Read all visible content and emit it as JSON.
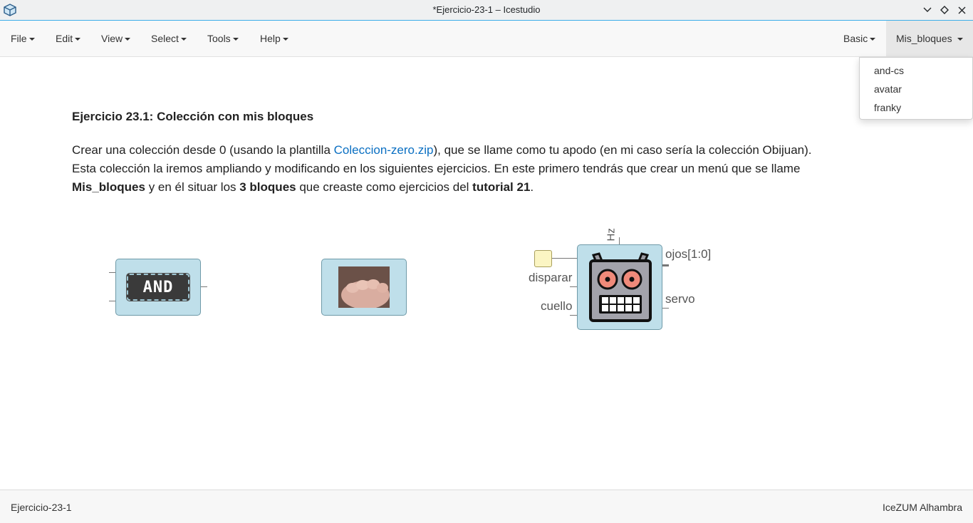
{
  "window": {
    "title": "*Ejercicio-23-1 – Icestudio",
    "icon": "icestudio-logo-icon",
    "controls": [
      "minimize-icon",
      "maximize-icon",
      "close-icon"
    ]
  },
  "menubar": {
    "left": [
      {
        "label": "File"
      },
      {
        "label": "Edit"
      },
      {
        "label": "View"
      },
      {
        "label": "Select"
      },
      {
        "label": "Tools"
      },
      {
        "label": "Help"
      }
    ],
    "right": [
      {
        "label": "Basic"
      },
      {
        "label": "Mis_bloques",
        "active": true
      }
    ]
  },
  "dropdown": {
    "items": [
      "and-cs",
      "avatar",
      "franky"
    ]
  },
  "document": {
    "heading": "Ejercicio 23.1: Colección con mis bloques",
    "p1_a": "Crear una colección desde 0 (usando la plantilla ",
    "p1_link": "Coleccion-zero.zip",
    "p1_b": "), que se llame como tu apodo (en mi caso sería la colección Obijuan).",
    "p2": "Esta colección la iremos ampliando y modificando en los siguientes ejercicios. En este primero tendrás que crear un menú que se llame",
    "p3_bold1": "Mis_bloques",
    "p3_a": " y en él situar los ",
    "p3_bold2": "3 bloques",
    "p3_b": " que creaste como ejercicios del ",
    "p3_bold3": "tutorial 21",
    "p3_c": "."
  },
  "blocks": {
    "and_label": "AND",
    "franky": {
      "top_label": "Hz",
      "inputs": [
        "disparar",
        "cuello"
      ],
      "outputs": [
        "ojos[1:0]",
        "servo"
      ]
    }
  },
  "statusbar": {
    "left": "Ejercicio-23-1",
    "right": "IceZUM Alhambra"
  },
  "colors": {
    "accent": "#3daee9",
    "link": "#0a6fc2",
    "block_bg": "#bfdfea",
    "robot_eye": "#f08a7a"
  }
}
